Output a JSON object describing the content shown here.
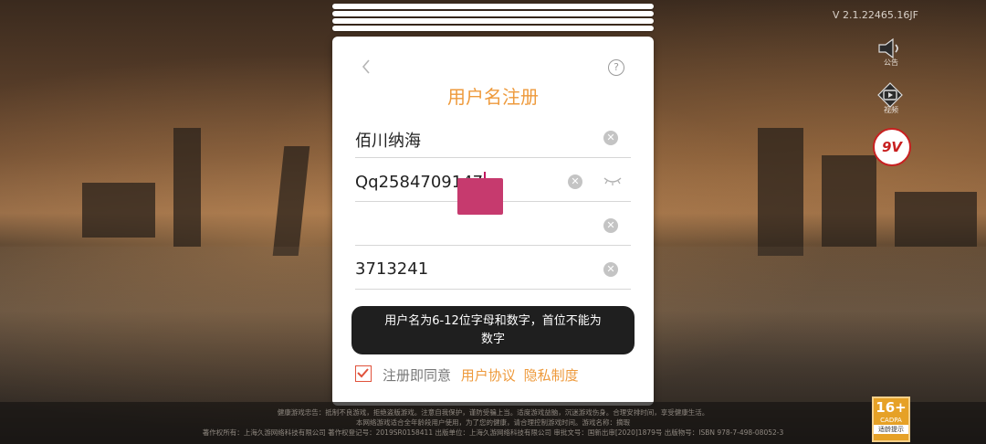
{
  "version": "V 2.1.22465.16JF",
  "side_buttons": {
    "announcement_label": "公告",
    "video_label": "视频",
    "hot_badge": "9V"
  },
  "register": {
    "title": "用户名注册",
    "username_value": "佰川纳海",
    "password_value": "Qq2584709147",
    "name_value": "",
    "idcard_value": "3713241",
    "clear_glyph": "✕",
    "help_glyph": "?"
  },
  "toast": {
    "line1": "用户名为6-12位字母和数字，首位不能为",
    "line2": "数字"
  },
  "agreement": {
    "prefix": "注册即同意",
    "user_agreement": "用户协议",
    "privacy": "隐私制度"
  },
  "footer": {
    "line1": "健康游戏忠告：抵制不良游戏，拒绝盗版游戏。注意自我保护，谨防受骗上当。适度游戏益脑，沉迷游戏伤身。合理安排时间，享受健康生活。",
    "line2": "本网络游戏适合全年龄段用户使用，为了您的健康，请合理控制游戏时间。游戏名称：摘瑕",
    "line3": "著作权所有：上海久游网络科技有限公司 著作权登记号：2019SR0158411 出版单位：上海久游网络科技有限公司 审批文号：国新出审[2020]1879号 出版物号：ISBN 978-7-498-08052-3"
  },
  "age_rating": {
    "rating": "16+",
    "org": "CADPA",
    "note": "适龄提示"
  },
  "colors": {
    "accent": "#ee9a3c",
    "checkbox": "#e0523b"
  }
}
